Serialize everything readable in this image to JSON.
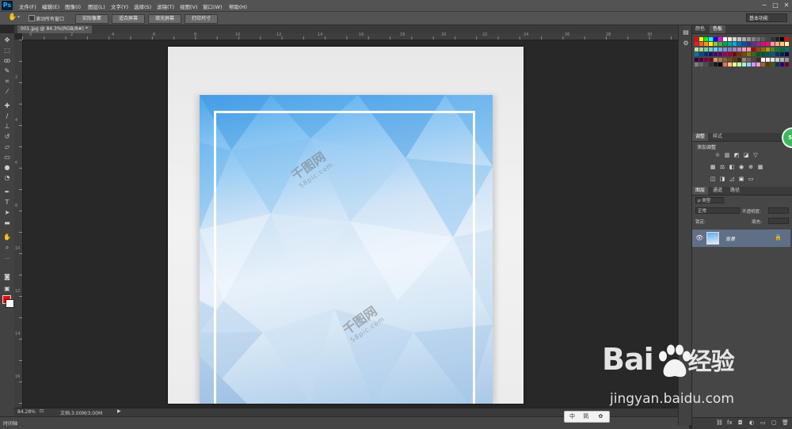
{
  "app": {
    "logo": "Ps"
  },
  "menu": [
    "文件(F)",
    "编辑(E)",
    "图像(I)",
    "图层(L)",
    "文字(Y)",
    "选择(S)",
    "滤镜(T)",
    "视图(V)",
    "窗口(W)",
    "帮助(H)"
  ],
  "window_controls": [
    "─",
    "□",
    "✕"
  ],
  "options": {
    "scroll_all_label": "滚动所有窗口",
    "buttons": [
      "实际像素",
      "适合屏幕",
      "填充屏幕",
      "打印尺寸"
    ],
    "workspace": "基本功能"
  },
  "document": {
    "tab_label": "001.jpg @ 84.3%(RGB/8#) *",
    "close": "×"
  },
  "ruler": {
    "top_ticks": [
      "0",
      "2",
      "4",
      "6",
      "8",
      "10",
      "12",
      "14",
      "16",
      "18",
      "20",
      "22",
      "24",
      "26",
      "28",
      "30"
    ],
    "left_ticks": [
      "2",
      "4",
      "6",
      "8",
      "10",
      "12",
      "14",
      "16"
    ]
  },
  "status": {
    "zoom": "84.28%",
    "doc_info": "文档:3.00M/3.00M",
    "timeline": "时间轴"
  },
  "panels": {
    "color_tabs": [
      "颜色",
      "色板"
    ],
    "adjust_tabs": [
      "调整",
      "样式"
    ],
    "adjust_title": "添加调整",
    "layers_tabs": [
      "图层",
      "通道",
      "路径"
    ],
    "kind_label": "ρ 类型",
    "blend_mode": "正常",
    "opacity_label": "不透明度:",
    "lock_label": "锁定:",
    "fill_label": "填充:",
    "layer_name": "背景"
  },
  "badge": "51",
  "watermark": {
    "brand": "Bai",
    "brand2": "经验",
    "url": "jingyan.baidu.com",
    "site": "千图网",
    "site_url": "58pic.com"
  },
  "ime": {
    "lang": "中",
    "mode": "简"
  },
  "colors": {
    "foreground": "#ff0000",
    "background": "#ffffff",
    "layer_selected": "#5f6f86"
  }
}
